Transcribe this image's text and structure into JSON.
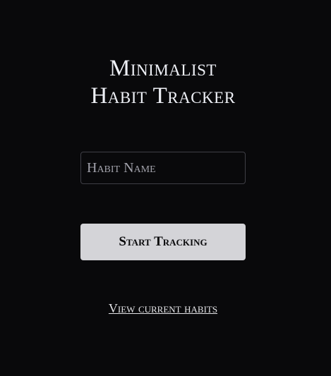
{
  "title": {
    "line1": "Minimalist",
    "line2": "Habit Tracker"
  },
  "form": {
    "habit_placeholder": "Habit Name",
    "habit_value": "",
    "submit_label": "Start Tracking"
  },
  "link": {
    "view_habits": "View current habits"
  },
  "colors": {
    "background": "#09090b",
    "button": "#d4d4d8",
    "text": "#e4e4e7"
  }
}
